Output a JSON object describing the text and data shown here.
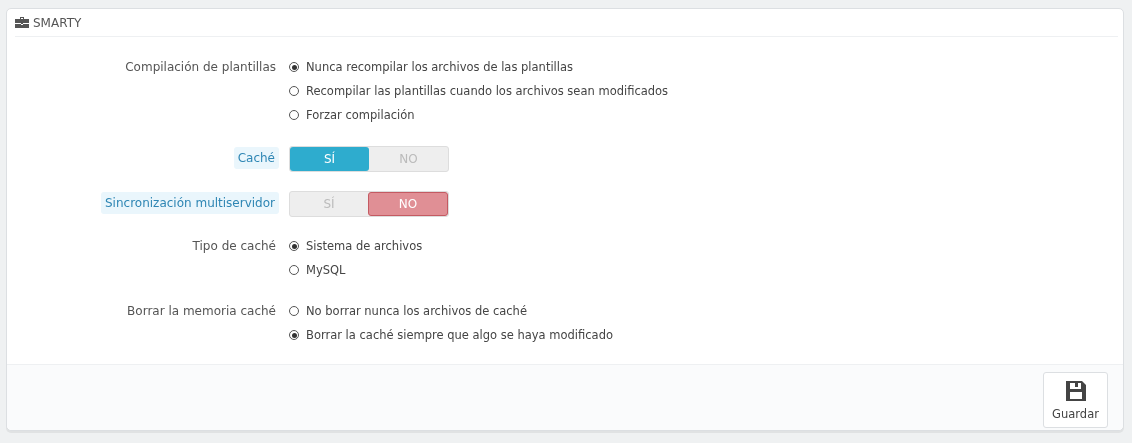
{
  "panel": {
    "title": "SMARTY"
  },
  "fields": [
    {
      "kind": "radio",
      "label": "Compilación de plantillas",
      "help": false,
      "options": [
        {
          "label": "Nunca recompilar los archivos de las plantillas",
          "selected": true
        },
        {
          "label": "Recompilar las plantillas cuando los archivos sean modificados",
          "selected": false
        },
        {
          "label": "Forzar compilación",
          "selected": false
        }
      ]
    },
    {
      "kind": "switch",
      "label": "Caché",
      "help": true,
      "options": [
        {
          "label": "SÍ",
          "selected": true
        },
        {
          "label": "NO",
          "selected": false
        }
      ]
    },
    {
      "kind": "switch",
      "label": "Sincronización multiservidor",
      "help": true,
      "options": [
        {
          "label": "SÍ",
          "selected": false
        },
        {
          "label": "NO",
          "selected": true
        }
      ]
    },
    {
      "kind": "radio",
      "label": "Tipo de caché",
      "help": false,
      "options": [
        {
          "label": "Sistema de archivos",
          "selected": true
        },
        {
          "label": "MySQL",
          "selected": false
        }
      ]
    },
    {
      "kind": "radio",
      "label": "Borrar la memoria caché",
      "help": false,
      "options": [
        {
          "label": "No borrar nunca los archivos de caché",
          "selected": false
        },
        {
          "label": "Borrar la caché siempre que algo se haya modificado",
          "selected": true
        }
      ]
    }
  ],
  "footer": {
    "save_label": "Guardar"
  }
}
